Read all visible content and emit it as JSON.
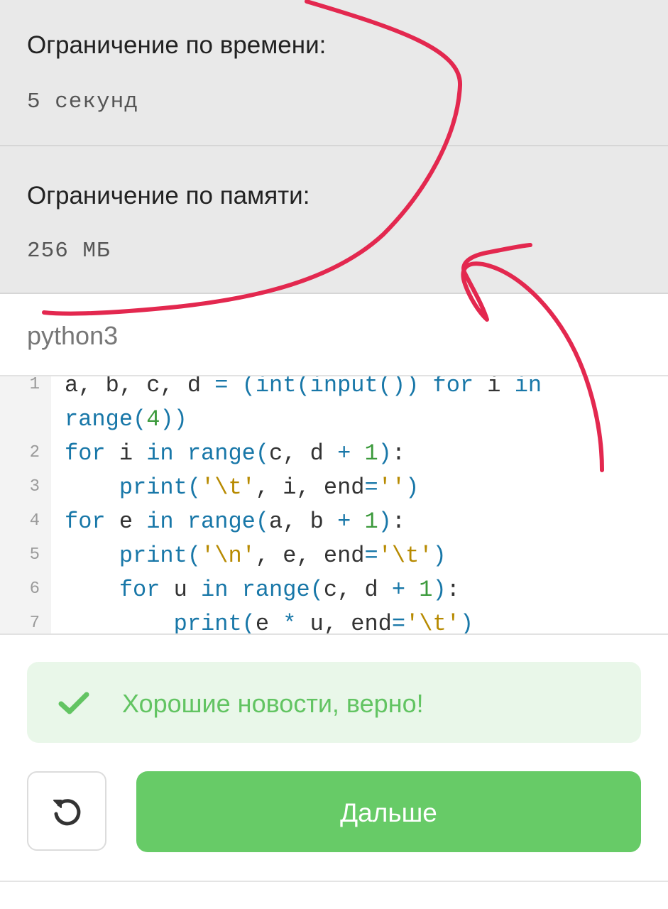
{
  "limits": {
    "time": {
      "label": "Ограничение по времени:",
      "value": "5 секунд"
    },
    "memory": {
      "label": "Ограничение по памяти:",
      "value": "256 МБ"
    }
  },
  "editor": {
    "language": "python3",
    "line_numbers": [
      "1",
      "2",
      "3",
      "4",
      "5",
      "6",
      "7"
    ],
    "lines": [
      "a, b, c, d = (int(input()) for i in",
      "range(4))",
      "for i in range(c, d + 1):",
      "    print('\\t', i, end='')",
      "for e in range(a, b + 1):",
      "    print('\\n', e, end='\\t')",
      "    for u in range(c, d + 1):",
      "        print(e * u, end='\\t')"
    ]
  },
  "feedback": {
    "icon": "check-icon",
    "text": "Хорошие новости, верно!",
    "color": "#62c462"
  },
  "actions": {
    "retry_icon": "retry-icon",
    "next_label": "Дальше",
    "next_color": "#67cb67"
  },
  "annotation": {
    "color": "#e3284f"
  }
}
